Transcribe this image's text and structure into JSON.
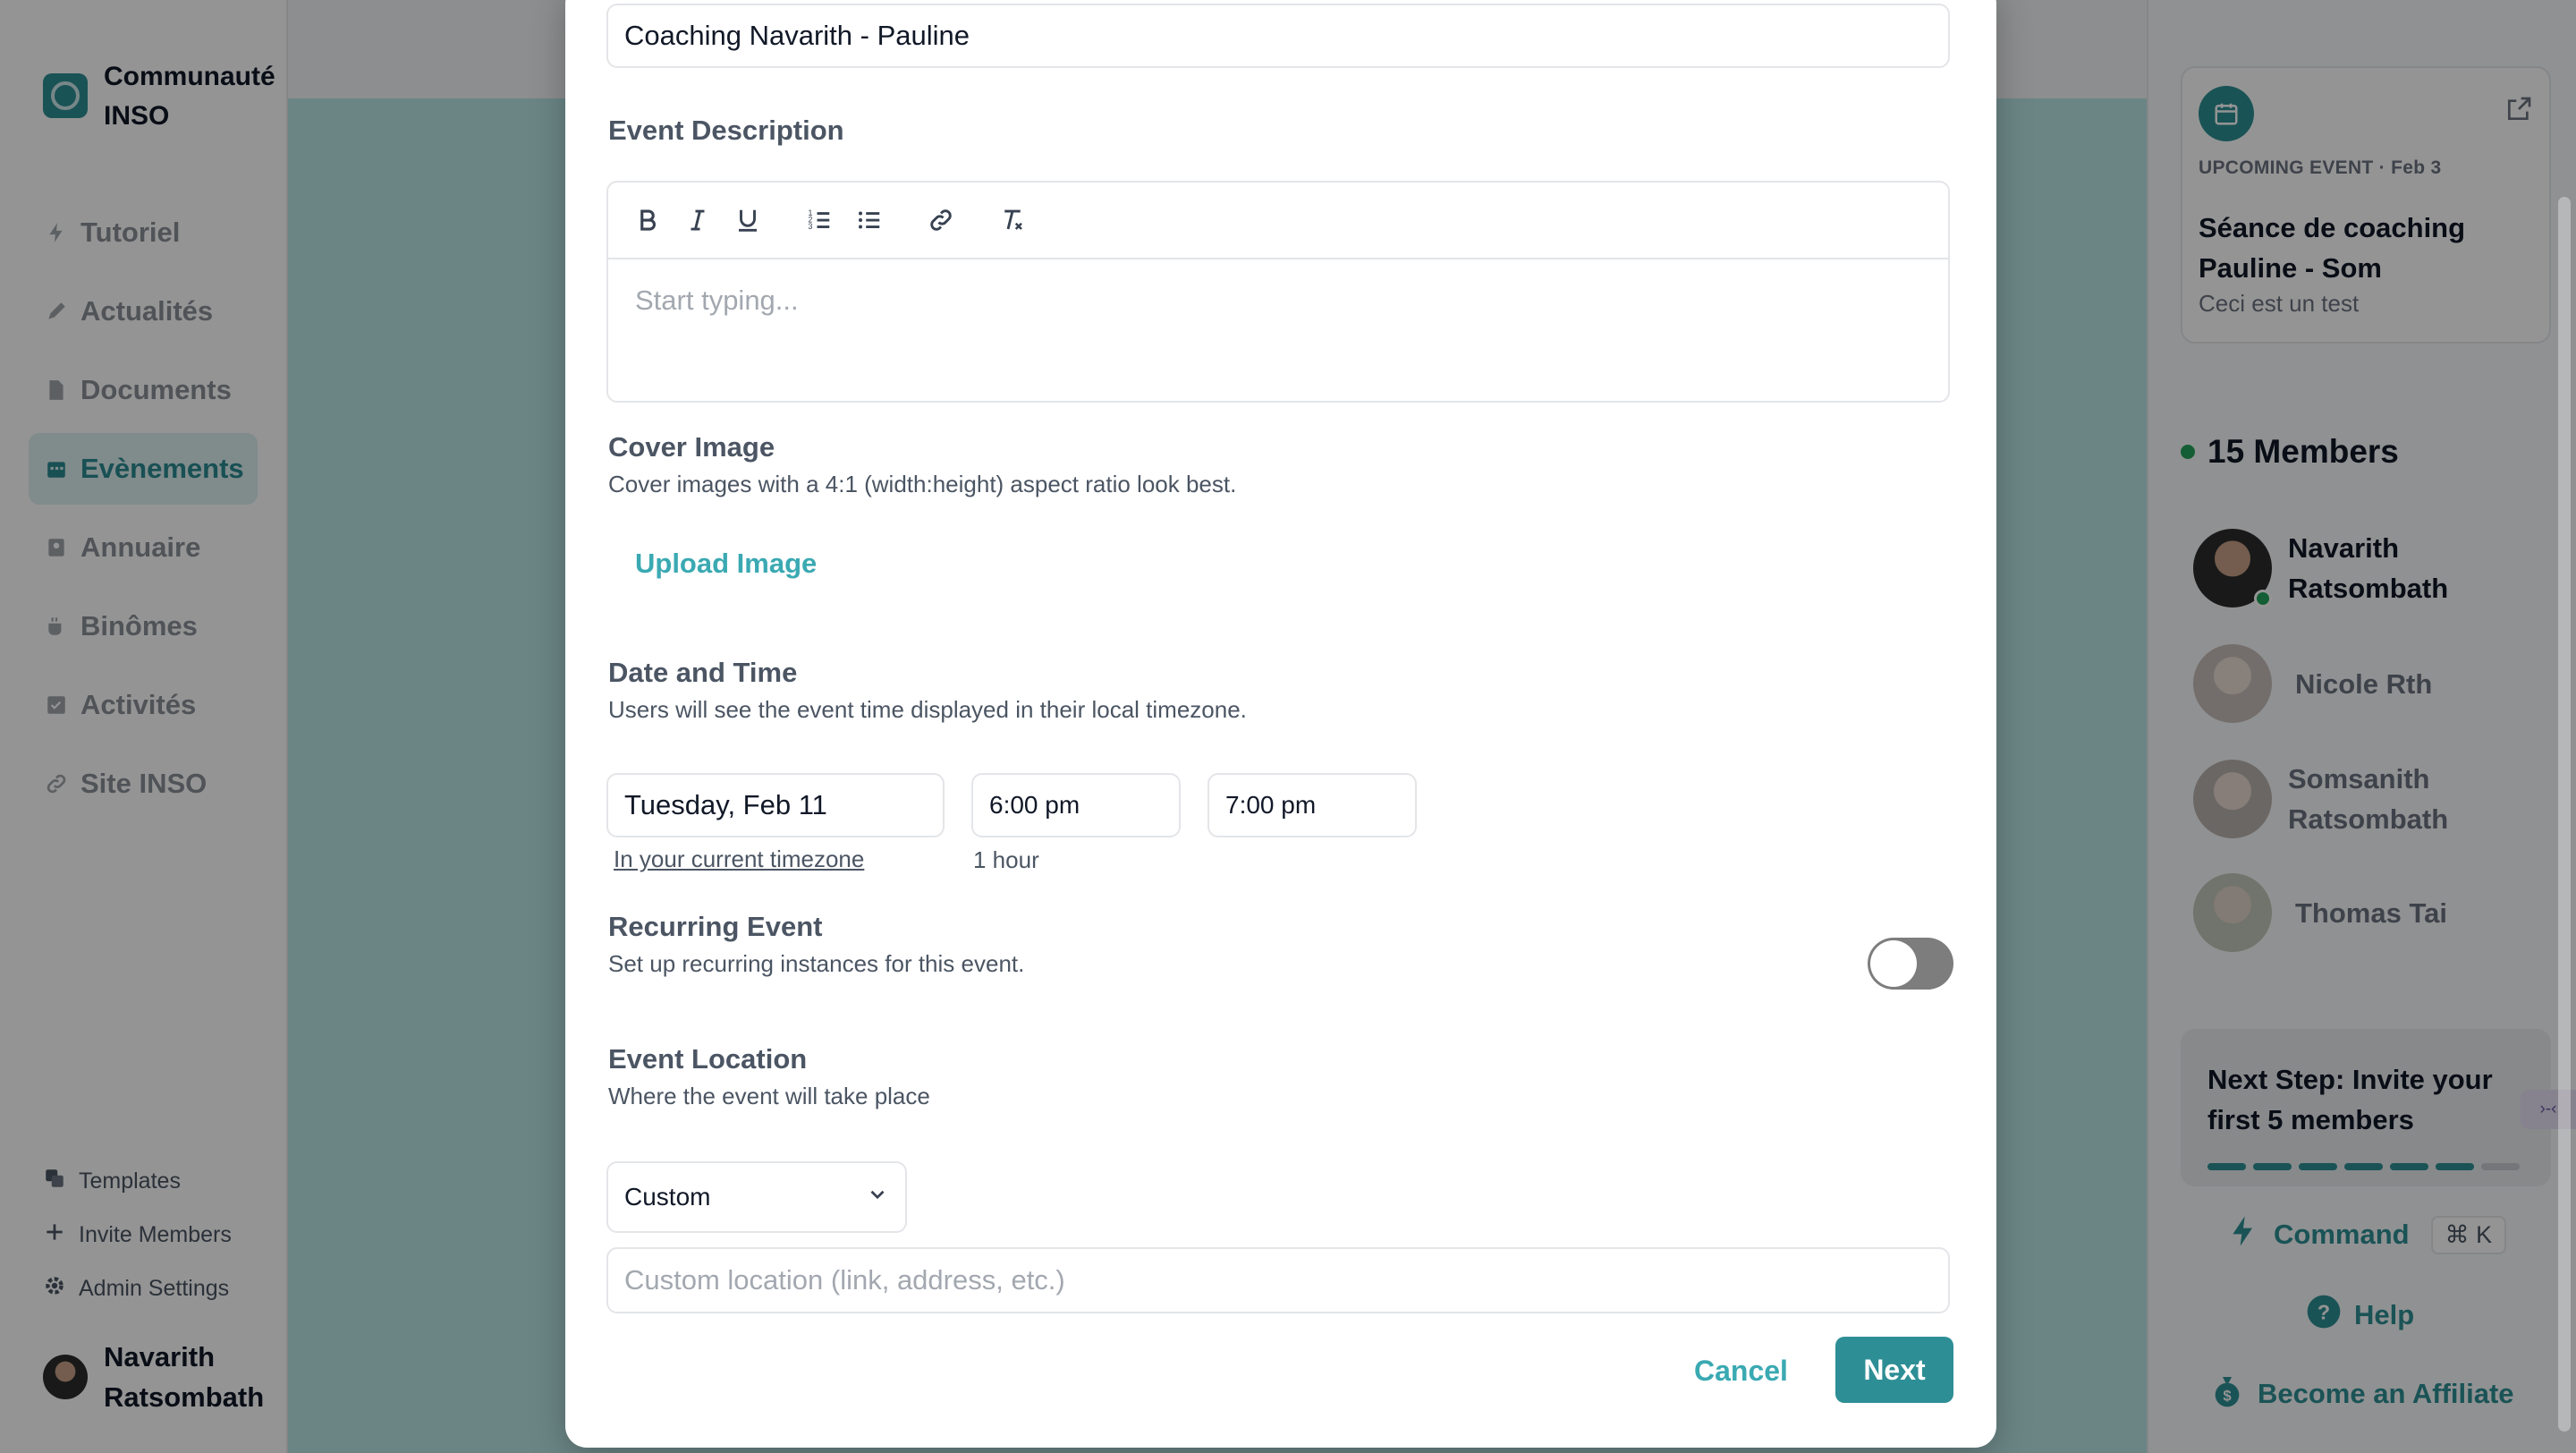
{
  "app": {
    "community_name": "Communauté INSO",
    "colors": {
      "accent": "#2d8f95",
      "accent_light": "#3aa9b2",
      "online": "#22a35a"
    }
  },
  "sidebar": {
    "nav": [
      {
        "label": "Tutoriel",
        "icon": "bolt-icon",
        "active": false
      },
      {
        "label": "Actualités",
        "icon": "pen-icon",
        "active": false
      },
      {
        "label": "Documents",
        "icon": "document-icon",
        "active": false
      },
      {
        "label": "Evènements",
        "icon": "calendar-icon",
        "active": true
      },
      {
        "label": "Annuaire",
        "icon": "contact-book-icon",
        "active": false
      },
      {
        "label": "Binômes",
        "icon": "coffee-icon",
        "active": false
      },
      {
        "label": "Activités",
        "icon": "checklist-icon",
        "active": false
      },
      {
        "label": "Site INSO",
        "icon": "link-icon",
        "active": false
      }
    ],
    "bottom_links": [
      {
        "label": "Templates",
        "icon": "templates-icon"
      },
      {
        "label": "Invite Members",
        "icon": "plus-icon"
      },
      {
        "label": "Admin Settings",
        "icon": "gear-icon"
      }
    ],
    "user_name": "Navarith Ratsombath"
  },
  "right_panel": {
    "upcoming": {
      "meta": "UPCOMING EVENT · Feb 3",
      "title": "Séance de coaching Pauline - Som",
      "description": "Ceci est un test"
    },
    "members_title": "15 Members",
    "members": [
      {
        "name": "Navarith Ratsombath",
        "online": true
      },
      {
        "name": "Nicole Rth",
        "online": false
      },
      {
        "name": "Somsanith Ratsombath",
        "online": false
      },
      {
        "name": "Thomas Tai",
        "online": false
      }
    ],
    "next_step": {
      "title": "Next Step: Invite your first 5 members",
      "progress_done": 6,
      "progress_total": 7
    },
    "command": {
      "label": "Command",
      "shortcut": "⌘ K"
    },
    "help_label": "Help",
    "affiliate_label": "Become an Affiliate",
    "floating_tab": "›-‹"
  },
  "modal": {
    "event_name_value": "Coaching Navarith - Pauline",
    "description": {
      "title": "Event Description",
      "placeholder": "Start typing...",
      "toolbar": [
        "bold-icon",
        "italic-icon",
        "underline-icon",
        "ordered-list-icon",
        "bullet-list-icon",
        "link-icon",
        "clear-format-icon"
      ]
    },
    "cover": {
      "title": "Cover Image",
      "subtitle": "Cover images with a 4:1 (width:height) aspect ratio look best.",
      "upload_label": "Upload Image"
    },
    "datetime": {
      "title": "Date and Time",
      "subtitle": "Users will see the event time displayed in their local timezone.",
      "date": "Tuesday, Feb 11",
      "start": "6:00 pm",
      "end": "7:00 pm",
      "timezone_link": "In your current timezone",
      "duration": "1 hour"
    },
    "recurring": {
      "title": "Recurring Event",
      "subtitle": "Set up recurring instances for this event.",
      "enabled": false
    },
    "location": {
      "title": "Event Location",
      "subtitle": "Where the event will take place",
      "type": "Custom",
      "placeholder": "Custom location (link, address, etc.)"
    },
    "cancel_label": "Cancel",
    "next_label": "Next"
  }
}
